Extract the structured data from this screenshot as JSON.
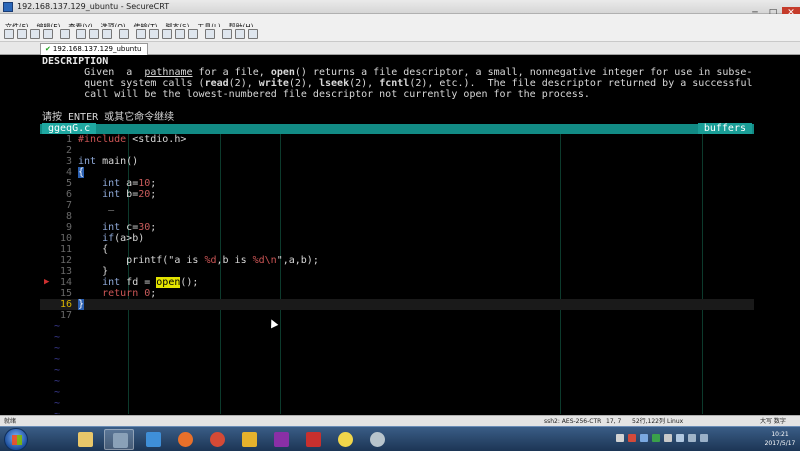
{
  "window": {
    "title": "192.168.137.129_ubuntu - SecureCRT",
    "controls": [
      "─",
      "□",
      "✕"
    ]
  },
  "menu": [
    "文件(F)",
    "编辑(E)",
    "查看(V)",
    "选项(O)",
    "传输(T)",
    "脚本(S)",
    "工具(L)",
    "帮助(H)"
  ],
  "session_tab": {
    "check": "✔",
    "label": "192.168.137.129_ubuntu"
  },
  "man": {
    "heading": "DESCRIPTION",
    "line1_a": "       Given  a  ",
    "line1_pathname": "pathname",
    "line1_b": " for a file, ",
    "line1_open": "open",
    "line1_c": "() returns a file descriptor, a small, nonnegative integer for use in subse‐",
    "line2_a": "       quent system calls (",
    "line2_read": "read",
    "line2_b": "(2), ",
    "line2_write": "write",
    "line2_c": "(2), ",
    "line2_lseek": "lseek",
    "line2_d": "(2), ",
    "line2_fcntl": "fcntl",
    "line2_e": "(2), etc.).  The file descriptor returned by a successful",
    "line3": "       call will be the lowest-numbered file descriptor not currently open for the process.",
    "prompt": "请按 ENTER 或其它命令继续"
  },
  "editor": {
    "filename": "ggeqG.c",
    "buffers_label": "buffers",
    "lines": [
      {
        "n": "1",
        "parts": [
          [
            "pp",
            "#include "
          ],
          [
            "",
            "<stdio.h>"
          ]
        ]
      },
      {
        "n": "2",
        "parts": []
      },
      {
        "n": "3",
        "parts": [
          [
            "kw",
            "int"
          ],
          [
            "",
            " main()"
          ]
        ]
      },
      {
        "n": "4",
        "parts": [
          [
            "brace-hl",
            "{"
          ]
        ]
      },
      {
        "n": "5",
        "parts": [
          [
            "",
            "    "
          ],
          [
            "kw",
            "int"
          ],
          [
            "",
            " a="
          ],
          [
            "num-c",
            "10"
          ],
          [
            "",
            ";"
          ]
        ]
      },
      {
        "n": "6",
        "parts": [
          [
            "",
            "    "
          ],
          [
            "kw",
            "int"
          ],
          [
            "",
            " b="
          ],
          [
            "num-c",
            "20"
          ],
          [
            "",
            ";"
          ]
        ]
      },
      {
        "n": "7",
        "parts": [
          [
            "",
            "     _"
          ]
        ]
      },
      {
        "n": "8",
        "parts": []
      },
      {
        "n": "9",
        "parts": [
          [
            "",
            "    "
          ],
          [
            "kw",
            "int"
          ],
          [
            "",
            " c="
          ],
          [
            "num-c",
            "30"
          ],
          [
            "",
            ";"
          ]
        ]
      },
      {
        "n": "10",
        "parts": [
          [
            "",
            "    "
          ],
          [
            "kw",
            "if"
          ],
          [
            "",
            "(a>b)"
          ]
        ]
      },
      {
        "n": "11",
        "parts": [
          [
            "",
            "    {"
          ]
        ]
      },
      {
        "n": "12",
        "parts": [
          [
            "",
            "        printf(\"a is "
          ],
          [
            "fmt",
            "%d"
          ],
          [
            "",
            ",b is "
          ],
          [
            "fmt",
            "%d\\n"
          ],
          [
            "",
            "\",a,b);"
          ]
        ]
      },
      {
        "n": "13",
        "parts": [
          [
            "",
            "    }"
          ]
        ]
      },
      {
        "n": "14",
        "parts": [
          [
            "",
            "    "
          ],
          [
            "kw",
            "int"
          ],
          [
            "",
            " fd = "
          ],
          [
            "search-hl",
            "open"
          ],
          [
            "",
            "();"
          ]
        ]
      },
      {
        "n": "15",
        "parts": [
          [
            "",
            "    "
          ],
          [
            "pp",
            "return"
          ],
          [
            "",
            " "
          ],
          [
            "num-c",
            "0"
          ],
          [
            "",
            ";"
          ]
        ]
      },
      {
        "n": "16",
        "parts": [
          [
            "brace-hl",
            "}"
          ]
        ]
      },
      {
        "n": "17",
        "parts": []
      }
    ],
    "tilde": "~"
  },
  "status": {
    "left": "就绪",
    "ssh": "ssh2: AES-256-CTR",
    "pos": "17,  7",
    "size": "52行,122列",
    "os": "Linux",
    "caps": "大写  数字"
  },
  "taskbar": {
    "time": "10:21",
    "date": "2017/5/17"
  },
  "colors": {
    "ctrlbar": "#128b85",
    "accent_blue": "#2a5fb0",
    "search_highlight": "#e4e400"
  }
}
